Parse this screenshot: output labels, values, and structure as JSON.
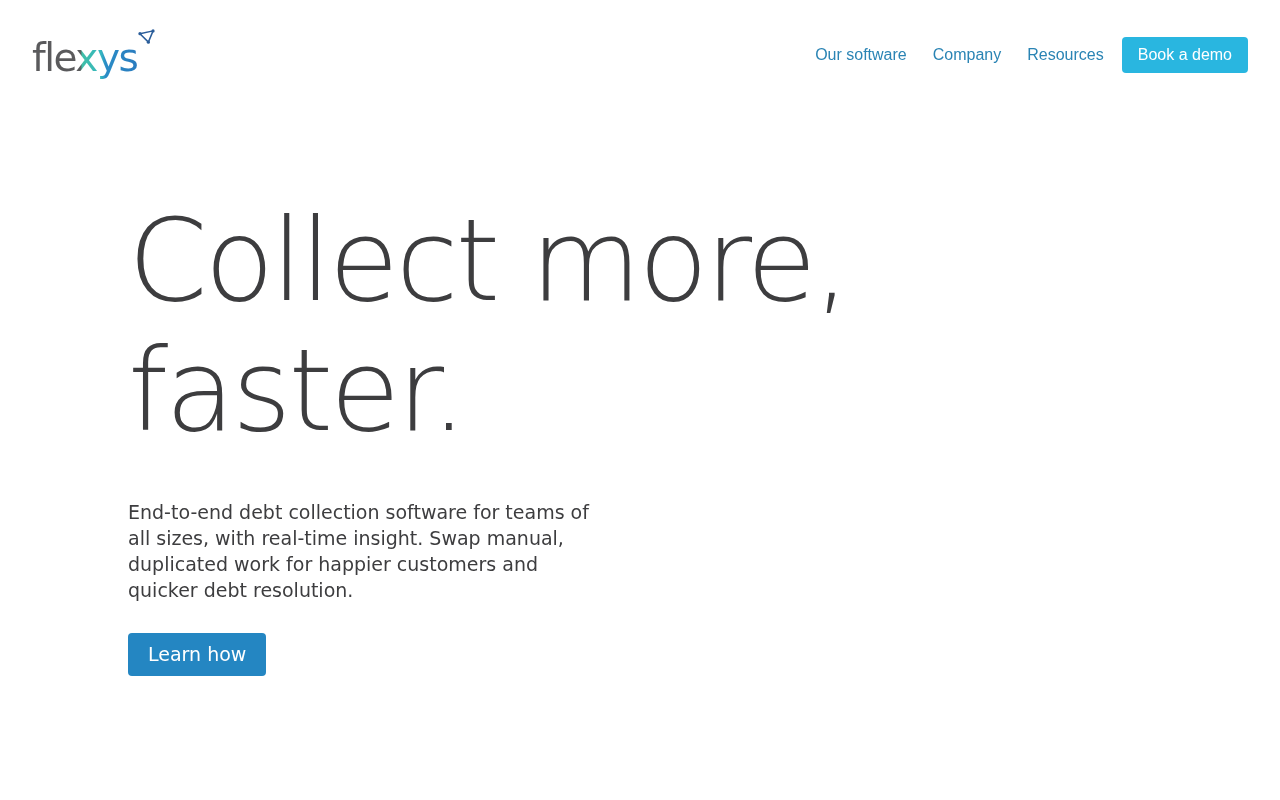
{
  "header": {
    "logo": {
      "text": "flexys"
    },
    "nav": [
      {
        "label": "Our software",
        "kind": "link"
      },
      {
        "label": "Company",
        "kind": "link"
      },
      {
        "label": "Resources",
        "kind": "link"
      },
      {
        "label": "Book a demo",
        "kind": "button"
      }
    ]
  },
  "hero": {
    "headline_lines": [
      "Collect more,",
      "faster."
    ],
    "description": "End-to-end debt collection software for teams of all sizes, with real-time insight. Swap manual, duplicated work for happier customers and quicker debt resolution.",
    "cta": "Learn how"
  }
}
